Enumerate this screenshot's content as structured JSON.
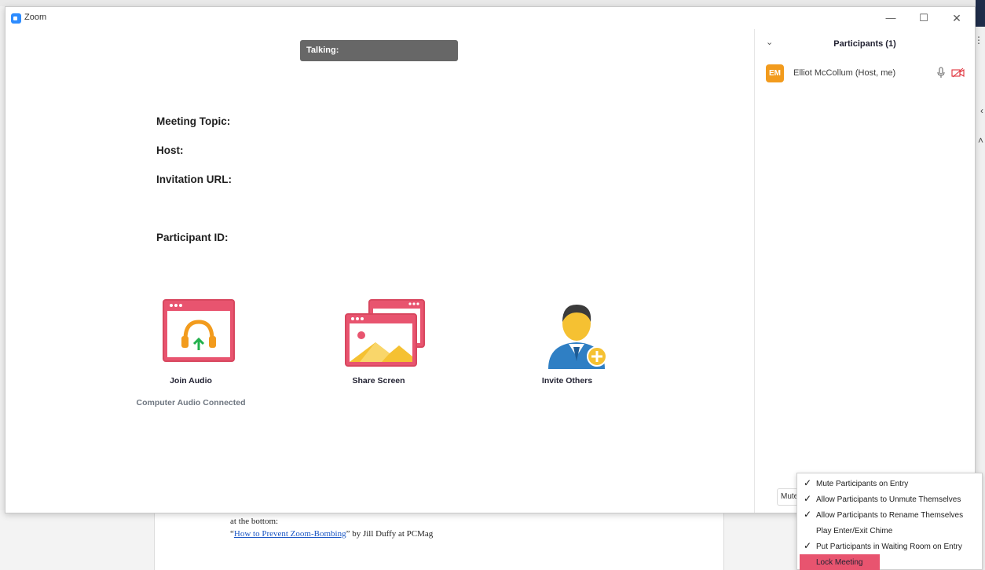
{
  "window": {
    "title": "Zoom",
    "minimize_icon": "minimize-icon",
    "maximize_icon": "maximize-icon",
    "close_icon": "close-icon"
  },
  "main": {
    "talking_label": "Talking:",
    "info": {
      "meeting_topic_label": "Meeting Topic:",
      "host_label": "Host:",
      "invitation_url_label": "Invitation URL:",
      "participant_id_label": "Participant ID:"
    },
    "actions": {
      "join_audio": {
        "label": "Join Audio",
        "status": "Computer Audio Connected",
        "icon": "headphones-icon"
      },
      "share_screen": {
        "label": "Share Screen",
        "icon": "share-screen-icon"
      },
      "invite_others": {
        "label": "Invite Others",
        "icon": "invite-person-icon"
      }
    }
  },
  "participants_panel": {
    "title": "Participants (1)",
    "participants": [
      {
        "initials": "EM",
        "name": "Elliot McCollum (Host, me)",
        "avatar_color": "#f29b1d",
        "mic_icon": "microphone-icon",
        "video_icon": "video-off-icon"
      }
    ],
    "mute_button_label": "Mute"
  },
  "more_menu": {
    "items": [
      {
        "label": "Mute Participants on Entry",
        "checked": true
      },
      {
        "label": "Allow Participants to Unmute Themselves",
        "checked": true
      },
      {
        "label": "Allow Participants to Rename Themselves",
        "checked": true
      },
      {
        "label": "Play Enter/Exit Chime",
        "checked": false
      },
      {
        "label": "Put Participants in Waiting Room on Entry",
        "checked": true
      },
      {
        "label": "Lock Meeting",
        "checked": false,
        "highlighted": true
      }
    ],
    "highlight_color": "#e8546f"
  },
  "background_doc": {
    "line1": "at the bottom:",
    "quote_open": "“",
    "link_text": "How to Prevent Zoom-Bombing",
    "quote_close": "”",
    "line2_suffix": " by Jill Duffy at PCMag"
  },
  "colors": {
    "brand_blue": "#2d8cff",
    "accent_red": "#e8546f",
    "avatar_orange": "#f29b1d"
  }
}
